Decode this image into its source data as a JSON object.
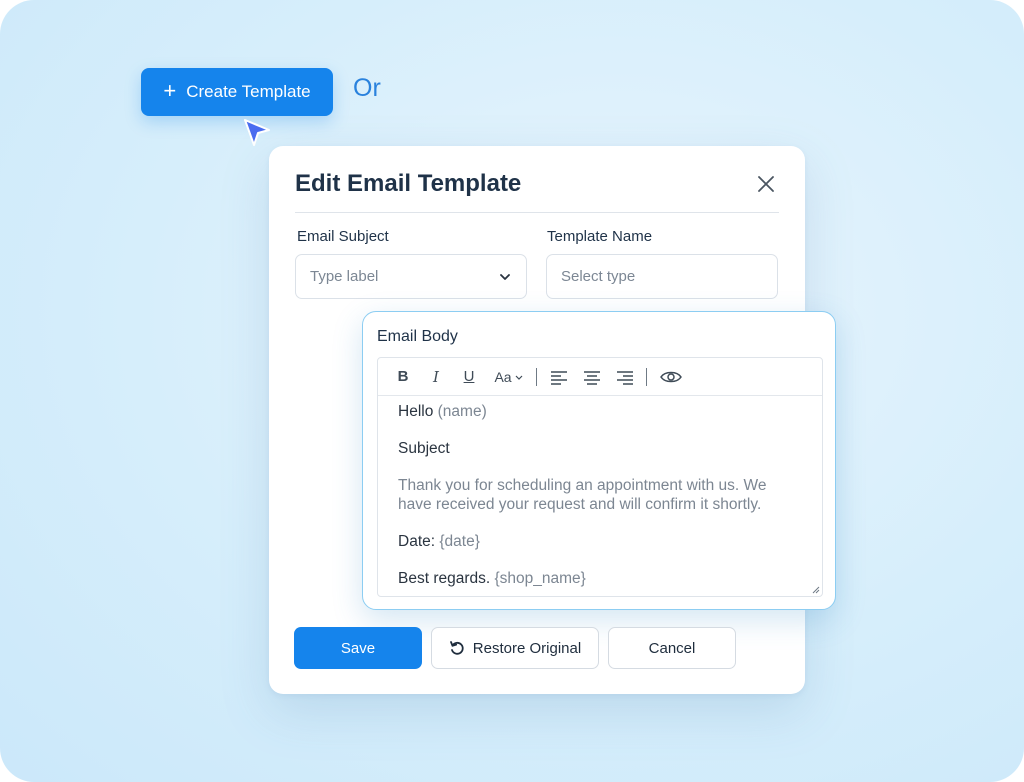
{
  "toolbar_top": {
    "create_label": "Create Template",
    "or_label": "Or"
  },
  "modal": {
    "title": "Edit Email Template",
    "subject_label": "Email Subject",
    "subject_placeholder": "Type label",
    "template_name_label": "Template Name",
    "template_name_placeholder": "Select type"
  },
  "body": {
    "label": "Email Body",
    "font_tool": "Aa",
    "lines": {
      "hello": "Hello",
      "hello_var": "(name)",
      "subject": "Subject",
      "message": "Thank you for scheduling an appointment with us. We have received your request and will confirm it shortly.",
      "date_label": "Date:",
      "date_var": "{date}",
      "regards": "Best regards.",
      "regards_var": "{shop_name}"
    }
  },
  "actions": {
    "save": "Save",
    "restore": "Restore Original",
    "cancel": "Cancel"
  },
  "colors": {
    "primary": "#1584ec",
    "accent_border": "#8ccdf2",
    "cursor": "#4a6cf0"
  },
  "icons": {
    "plus": "plus-icon",
    "close": "close-icon",
    "chevron": "chevron-down-icon",
    "restore": "restore-icon",
    "preview": "eye-icon"
  }
}
